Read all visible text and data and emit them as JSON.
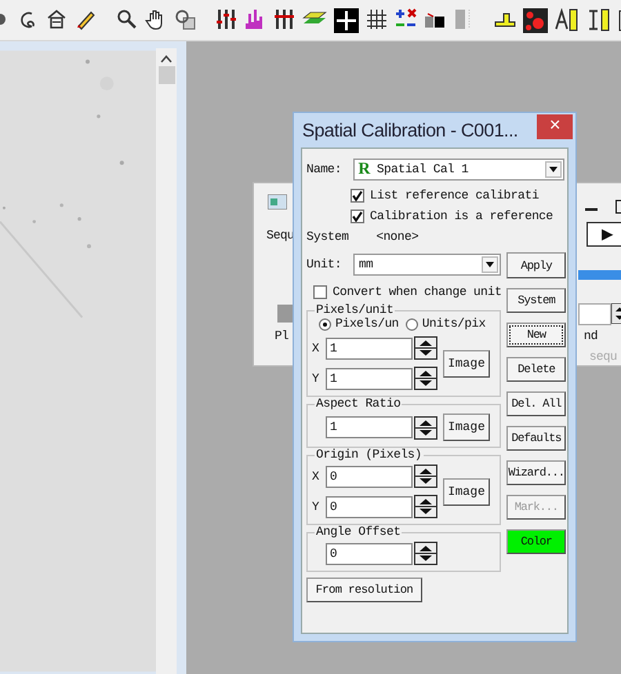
{
  "background_window": {
    "texts_left": [
      "Sequ",
      "Pl"
    ],
    "texts_right": [
      {
        "text": "nd",
        "disabled": false
      },
      {
        "text": "sequ",
        "disabled": true
      }
    ],
    "play_button": "▶",
    "bar": {
      "level": 1
    }
  },
  "dialog": {
    "title": "Spatial Calibration - C001...",
    "close": "×",
    "name": {
      "label": "Name:",
      "badge": "R",
      "value": "Spatial Cal 1"
    },
    "checkboxes": [
      {
        "label": "List reference calibrati",
        "checked": true
      },
      {
        "label": "Calibration is a reference",
        "checked": true
      }
    ],
    "system": {
      "label": "System",
      "value": "<none>"
    },
    "unit": {
      "label": "Unit:",
      "value": "mm"
    },
    "convert": {
      "label": "Convert when change unit",
      "checked": false
    },
    "pixels_unit": {
      "title": "Pixels/unit",
      "radios": [
        {
          "label": "Pixels/un",
          "selected": true
        },
        {
          "label": "Units/pix",
          "selected": false
        }
      ],
      "x": {
        "label": "X",
        "value": "1"
      },
      "y": {
        "label": "Y",
        "value": "1"
      },
      "image_button": "Image"
    },
    "aspect_ratio": {
      "title": "Aspect Ratio",
      "value": "1",
      "image_button": "Image"
    },
    "origin": {
      "title": "Origin (Pixels)",
      "x": {
        "label": "X",
        "value": "0"
      },
      "y": {
        "label": "Y",
        "value": "0"
      },
      "image_button": "Image"
    },
    "angle_offset": {
      "title": "Angle Offset",
      "value": "0"
    },
    "from_resolution": "From resolution",
    "buttons": [
      {
        "label": "Apply",
        "kind": "normal",
        "disabled": false,
        "focused": false
      },
      {
        "label": "System",
        "kind": "normal",
        "disabled": false,
        "focused": false
      },
      {
        "label": "New",
        "kind": "normal",
        "disabled": false,
        "focused": true
      },
      {
        "label": "Delete",
        "kind": "normal",
        "disabled": false,
        "focused": false
      },
      {
        "label": "Del. All",
        "kind": "normal",
        "disabled": false,
        "focused": false
      },
      {
        "label": "Defaults",
        "kind": "normal",
        "disabled": false,
        "focused": false
      },
      {
        "label": "Wizard...",
        "kind": "normal",
        "disabled": false,
        "focused": false
      },
      {
        "label": "Mark...",
        "kind": "normal",
        "disabled": true,
        "focused": false
      },
      {
        "label": "Color",
        "kind": "color",
        "disabled": false,
        "focused": false
      }
    ]
  }
}
